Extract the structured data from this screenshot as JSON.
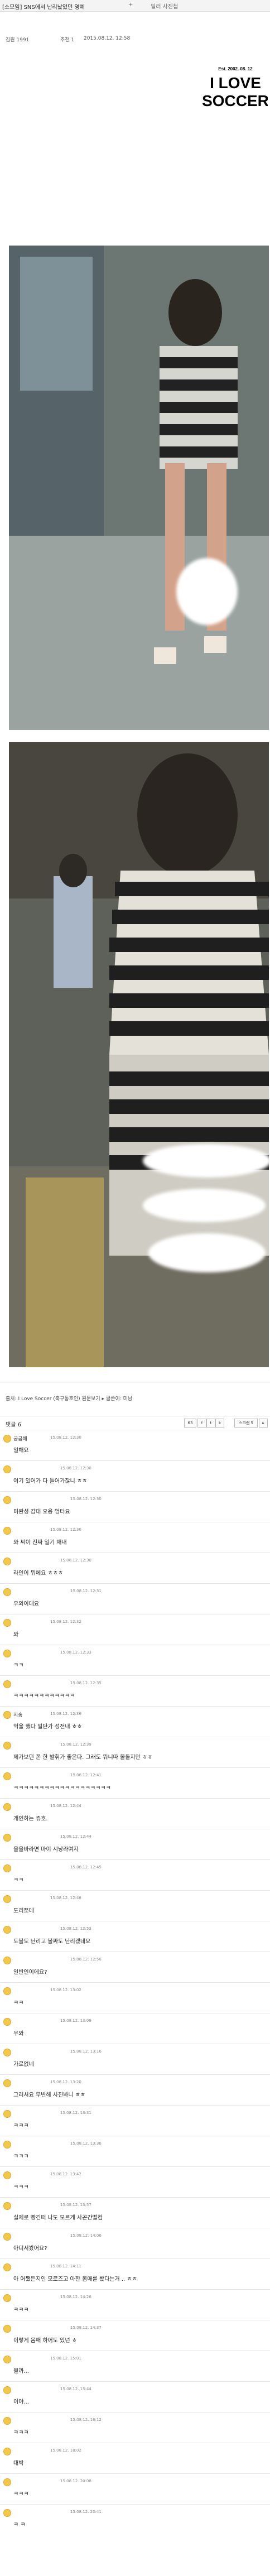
{
  "page": {
    "title": "[소모임] SNS에서 난리났었던 영예",
    "badge_plus": "+",
    "badge_other": "일러 사진첩",
    "meta_author": "김원 1991",
    "meta_views": "추천 1",
    "meta_date": "2015.08.12. 12:58"
  },
  "logo": {
    "est": "Est. 2002. 08. 12",
    "line1": "I LOVE",
    "line2": "SOCCER"
  },
  "footer": {
    "text": "출처: I Love Soccer (축구동호인) 원문보기 ▸ 글쓴이: 미남"
  },
  "share": {
    "buttons": [
      "f",
      "t",
      "k",
      "▸"
    ]
  },
  "comments_header": {
    "label": "댓글 ",
    "count": "6",
    "button_count": "63",
    "pill_right": "스크랩 5"
  },
  "comments": [
    {
      "nick": "궁금해",
      "date": "15.08.12. 12:30",
      "text": "일해요"
    },
    {
      "nick": "",
      "date": "15.08.12. 12:30",
      "text": "여기 있어가 다 들어가잖니 ㅎㅎ"
    },
    {
      "nick": "",
      "date": "15.08.12. 12:30",
      "text": "미완셩 감대 오옹 엉터요"
    },
    {
      "nick": "",
      "date": "15.08.12. 12:30",
      "text": "와 씨이 진짜 일기 재내"
    },
    {
      "nick": "",
      "date": "15.08.12. 12:30",
      "text": "라인이 뭐에요 ㅎㅎㅎ"
    },
    {
      "nick": "",
      "date": "15.08.12. 12:31",
      "text": "우와이대요"
    },
    {
      "nick": "",
      "date": "15.08.12. 12:32",
      "text": "와"
    },
    {
      "nick": "",
      "date": "15.08.12. 12:33",
      "text": "ㅋㅋ"
    },
    {
      "nick": "",
      "date": "15.08.12. 12:35",
      "text": "ㅋㅋㅋㅋㅋㅋㅋㅋㅋㅋㅋㅋ"
    },
    {
      "nick": "지송",
      "date": "15.08.12. 12:36",
      "text": "억울 했다 일단가 성전내 ㅎㅎ"
    },
    {
      "nick": "",
      "date": "15.08.12. 12:39",
      "text": "제가보던 폰 한 발휘가 좋은다. 그래도 뭐니따 볼돌지만 ㅎㅎ"
    },
    {
      "nick": "",
      "date": "15.08.12. 12:41",
      "text": "ㅋㅋㅋㅋㅋㅋㅋㅋㅋㅋㅋㅋㅋㅋㅋㅋㅋㅋㅋ"
    },
    {
      "nick": "",
      "date": "15.08.12. 12:44",
      "text": "개인하는 쥬호."
    },
    {
      "nick": "",
      "date": "15.08.12. 12:44",
      "text": "을을바라면 마이 시낭라여지"
    },
    {
      "nick": "",
      "date": "15.08.12. 12:45",
      "text": "ㅋㅋ"
    },
    {
      "nick": "",
      "date": "15.08.12. 12:48",
      "text": "도리쪼데"
    },
    {
      "nick": "",
      "date": "15.08.12. 12:53",
      "text": "도블도 난리고 볼짜도 난리겠네요"
    },
    {
      "nick": "",
      "date": "15.08.12. 12:56",
      "text": "일반인이에요?"
    },
    {
      "nick": "",
      "date": "15.08.12. 13:02",
      "text": "ㅋㅋ"
    },
    {
      "nick": "",
      "date": "15.08.12. 13:09",
      "text": "우와"
    },
    {
      "nick": "",
      "date": "15.08.12. 13:16",
      "text": "가로없네"
    },
    {
      "nick": "",
      "date": "15.08.12. 13:20",
      "text": "그러셔요 무변해 사진봐니 ㅎㅎ"
    },
    {
      "nick": "",
      "date": "15.08.12. 13:31",
      "text": "ㅋㅋㅋ"
    },
    {
      "nick": "",
      "date": "15.08.12. 13:36",
      "text": "ㅋㅋㅋ"
    },
    {
      "nick": "",
      "date": "15.08.12. 13:42",
      "text": "ㅋㅋㅋ"
    },
    {
      "nick": "",
      "date": "15.08.12. 13:57",
      "text": "실제로 빵긴떠 나도 모르게 사곤간떨컴"
    },
    {
      "nick": "",
      "date": "15.08.12. 14:06",
      "text": "아디서봤어요?"
    },
    {
      "nick": "",
      "date": "15.08.12. 14:11",
      "text": "아 어쨌든지인 모르즈고 아한 몸매를 봤다는거 .. ㅎㅎ"
    },
    {
      "nick": "",
      "date": "15.08.12. 14:26",
      "text": "ㅋㅋㅋ"
    },
    {
      "nick": "",
      "date": "15.08.12. 14:37",
      "text": "이렇게 몸매 하어도 있넌 ㅎ"
    },
    {
      "nick": "",
      "date": "15.08.12. 15:01",
      "text": "웰까..."
    },
    {
      "nick": "",
      "date": "15.08.12. 15:44",
      "text": "이야..."
    },
    {
      "nick": "",
      "date": "15.08.12. 16:12",
      "text": "ㅋㅋㅋ"
    },
    {
      "nick": "",
      "date": "15.08.12. 18:02",
      "text": "대박"
    },
    {
      "nick": "",
      "date": "15.08.12. 20:08",
      "text": "ㅋㅋㅋ"
    },
    {
      "nick": "",
      "date": "15.08.12. 20:41",
      "text": "ㅋ ㅋ"
    }
  ],
  "colors": {
    "avatar": "#f2c84b",
    "page_bg": "#ffffff",
    "divider": "#e6e6e6"
  }
}
